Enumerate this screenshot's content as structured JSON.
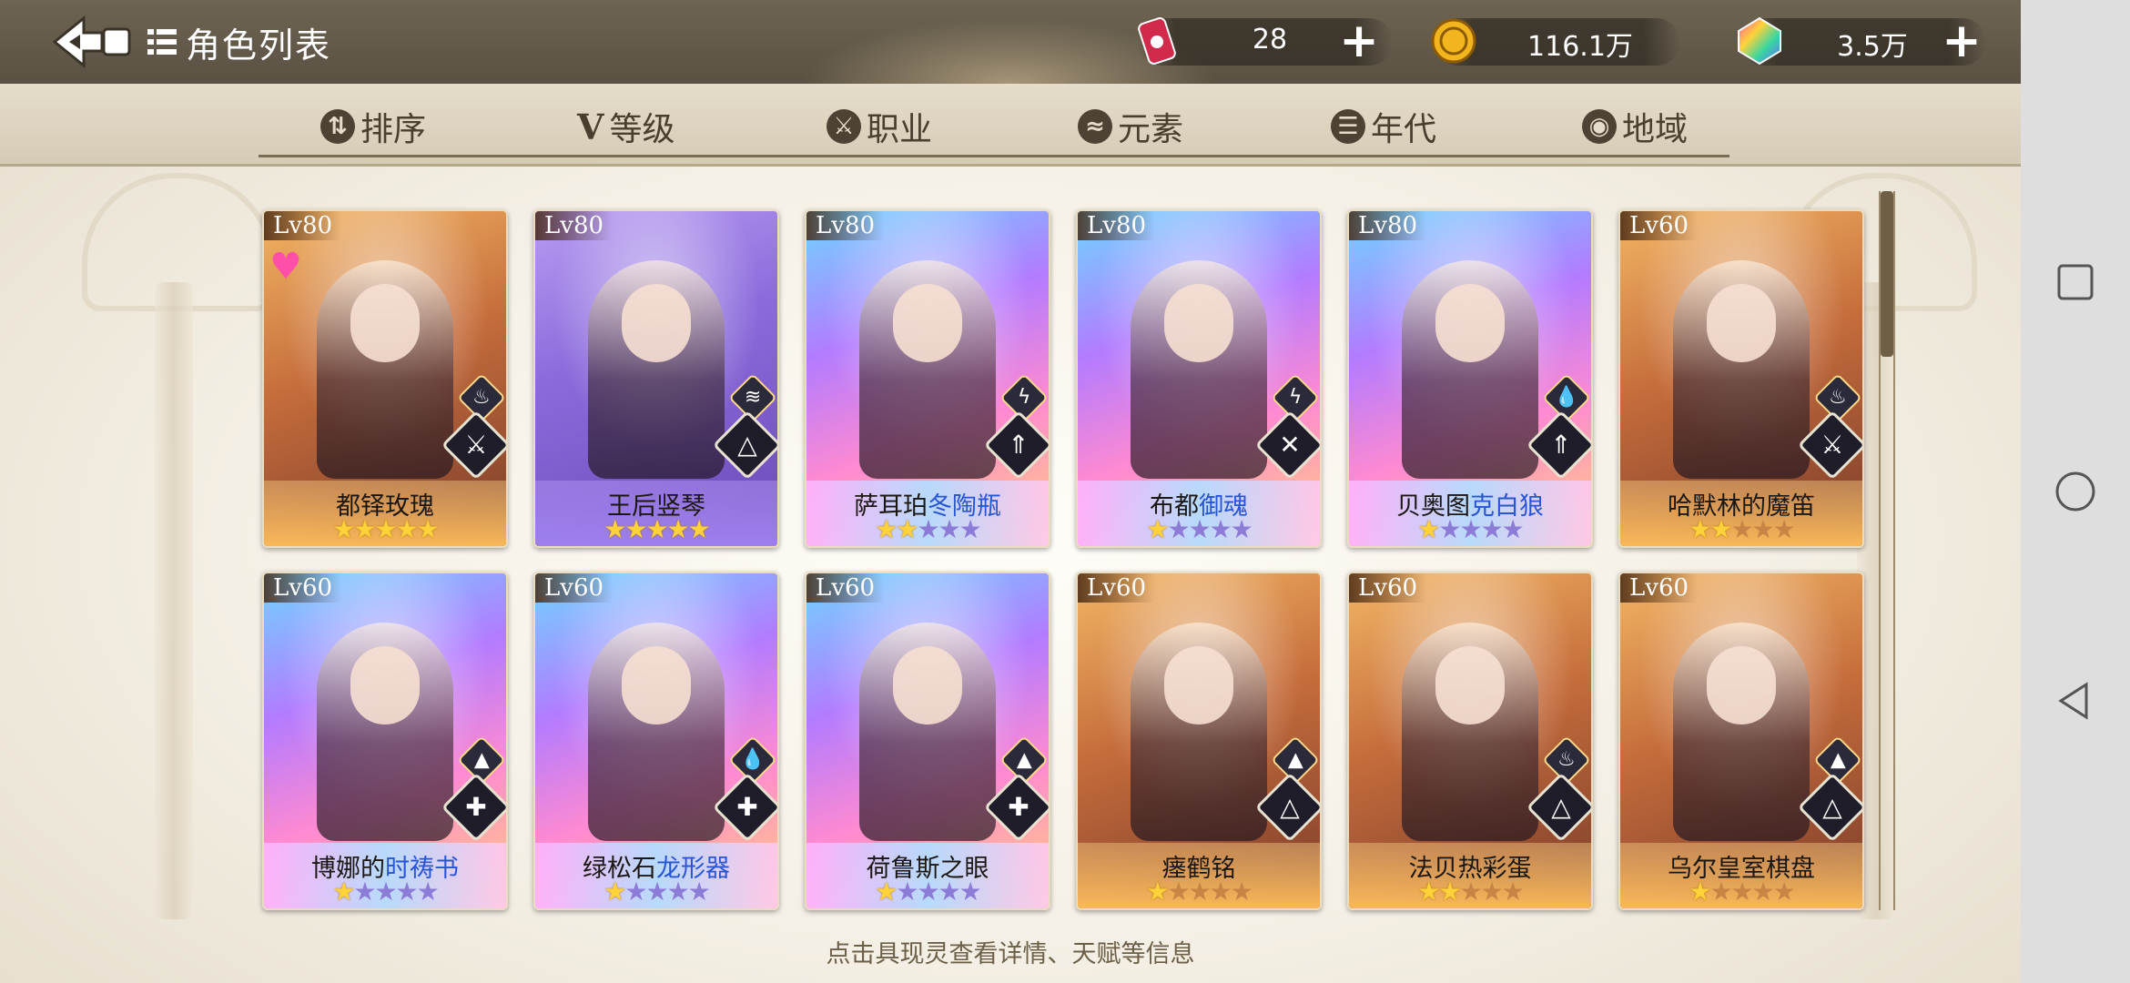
{
  "header": {
    "title": "角色列表",
    "back_icon": "back-arrow-icon",
    "list_icon": "list-icon"
  },
  "resources": [
    {
      "name": "stamina",
      "icon": "red-can-icon",
      "value": "28"
    },
    {
      "name": "gold",
      "icon": "gold-coin-icon",
      "value": "116.1万"
    },
    {
      "name": "gems",
      "icon": "rainbow-gem-icon",
      "value": "3.5万"
    }
  ],
  "tabs": [
    {
      "label": "排序",
      "icon": "sort-icon"
    },
    {
      "label": "等级",
      "icon": "level-v-icon"
    },
    {
      "label": "职业",
      "icon": "class-icon"
    },
    {
      "label": "元素",
      "icon": "element-icon"
    },
    {
      "label": "年代",
      "icon": "era-icon"
    },
    {
      "label": "地域",
      "icon": "location-pin-icon"
    }
  ],
  "cards": [
    {
      "lv": "Lv80",
      "name": "都铎玫瑰",
      "name_hl": "",
      "stars": 5,
      "theme": "gold",
      "element": "fire",
      "class": "assassin",
      "favorite": true
    },
    {
      "lv": "Lv80",
      "name": "王后竖琴",
      "name_hl": "",
      "stars": 5,
      "theme": "purple",
      "element": "wind",
      "class": "mage",
      "favorite": false
    },
    {
      "lv": "Lv80",
      "name": "萨耳珀",
      "name_hl": "冬陶瓶",
      "stars": 2,
      "theme": "holo",
      "element": "thunder",
      "class": "ranger",
      "favorite": false
    },
    {
      "lv": "Lv80",
      "name": "布都",
      "name_hl": "御魂",
      "stars": 1,
      "theme": "holo",
      "element": "thunder",
      "class": "warrior",
      "favorite": false
    },
    {
      "lv": "Lv80",
      "name": "贝奥图",
      "name_hl": "克白狼",
      "stars": 1,
      "theme": "holo",
      "element": "water",
      "class": "ranger",
      "favorite": false
    },
    {
      "lv": "Lv60",
      "name": "哈默林的魔笛",
      "name_hl": "",
      "stars": 2,
      "theme": "gold",
      "element": "fire",
      "class": "assassin",
      "favorite": false
    },
    {
      "lv": "Lv60",
      "name": "博娜的",
      "name_hl": "时祷书",
      "stars": 1,
      "theme": "holo",
      "element": "earth",
      "class": "healer",
      "favorite": false
    },
    {
      "lv": "Lv60",
      "name": "绿松石",
      "name_hl": "龙形器",
      "stars": 1,
      "theme": "holo",
      "element": "water",
      "class": "healer",
      "favorite": false
    },
    {
      "lv": "Lv60",
      "name": "荷鲁斯之眼",
      "name_hl": "",
      "stars": 1,
      "theme": "holo",
      "element": "earth",
      "class": "healer",
      "favorite": false
    },
    {
      "lv": "Lv60",
      "name": "瘗鹤铭",
      "name_hl": "",
      "stars": 1,
      "theme": "gold",
      "element": "earth",
      "class": "mage",
      "favorite": false
    },
    {
      "lv": "Lv60",
      "name": "法贝热彩蛋",
      "name_hl": "",
      "stars": 2,
      "theme": "gold",
      "element": "fire",
      "class": "mage",
      "favorite": false
    },
    {
      "lv": "Lv60",
      "name": "乌尔皇室棋盘",
      "name_hl": "",
      "stars": 1,
      "theme": "gold",
      "element": "earth",
      "class": "mage",
      "favorite": false
    }
  ],
  "hint": "点击具现灵查看详情、天赋等信息",
  "scroll": {
    "position": 0.0,
    "visible_fraction": 0.23
  }
}
